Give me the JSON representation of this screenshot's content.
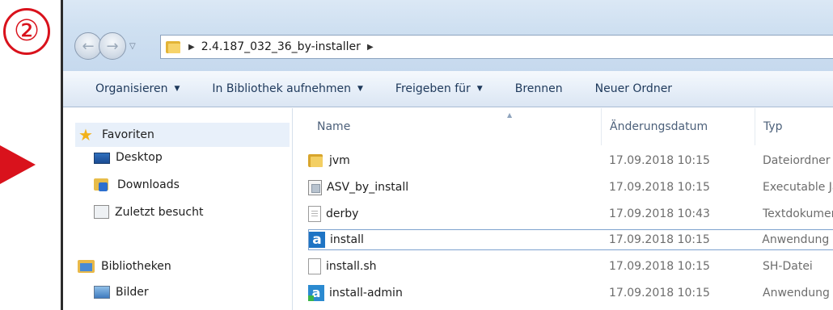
{
  "annotation": {
    "step_label": "②"
  },
  "window": {
    "address": {
      "path": "2.4.187_032_36_by-installer"
    },
    "toolbar": [
      {
        "label": "Organisieren",
        "dropdown": true
      },
      {
        "label": "In Bibliothek aufnehmen",
        "dropdown": true
      },
      {
        "label": "Freigeben für",
        "dropdown": true
      },
      {
        "label": "Brennen",
        "dropdown": false
      },
      {
        "label": "Neuer Ordner",
        "dropdown": false
      }
    ],
    "navigation": {
      "favorites": {
        "label": "Favoriten",
        "icon": "star-icon"
      },
      "items": [
        {
          "label": "Desktop",
          "icon": "desktop-icon"
        },
        {
          "label": "Downloads",
          "icon": "downloads-folder-icon"
        },
        {
          "label": "Zuletzt besucht",
          "icon": "recent-places-icon"
        }
      ],
      "libraries": {
        "label": "Bibliotheken",
        "icon": "libraries-icon"
      },
      "library_items": [
        {
          "label": "Bilder",
          "icon": "pictures-icon"
        }
      ]
    },
    "columns": {
      "name": "Name",
      "date": "Änderungsdatum",
      "type": "Typ"
    },
    "files": [
      {
        "name": "jvm",
        "date": "17.09.2018 10:15",
        "type": "Dateiordner",
        "icon": "folder-icon"
      },
      {
        "name": "ASV_by_install",
        "date": "17.09.2018 10:15",
        "type": "Executable Jar File",
        "icon": "executable-jar-icon"
      },
      {
        "name": "derby",
        "date": "17.09.2018 10:43",
        "type": "Textdokument",
        "icon": "text-document-icon"
      },
      {
        "name": "install",
        "date": "17.09.2018 10:15",
        "type": "Anwendung",
        "icon": "application-icon",
        "selected": true
      },
      {
        "name": "install.sh",
        "date": "17.09.2018 10:15",
        "type": "SH-Datei",
        "icon": "file-icon"
      },
      {
        "name": "install-admin",
        "date": "17.09.2018 10:15",
        "type": "Anwendung",
        "icon": "admin-application-icon"
      }
    ],
    "colors": {
      "annotation_red": "#d9121c",
      "selection_border": "#7da2ce",
      "toolbar_text": "#1e395b"
    }
  }
}
